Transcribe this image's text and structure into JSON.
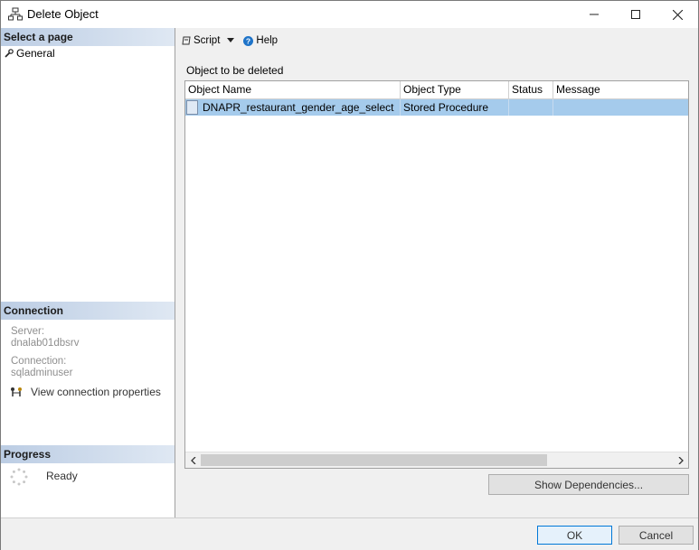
{
  "window": {
    "title": "Delete Object",
    "icon": "object-tree-icon",
    "controls": {
      "minimize": "—",
      "maximize": "☐",
      "close": "✕"
    }
  },
  "left": {
    "select_page_header": "Select a page",
    "pages": [
      {
        "label": "General",
        "icon": "wrench-icon"
      }
    ],
    "connection_header": "Connection",
    "server_label": "Server:",
    "server_value": "dnalab01dbsrv",
    "connection_label": "Connection:",
    "connection_value": "sqladminuser",
    "view_conn_props": "View connection properties",
    "progress_header": "Progress",
    "progress_status": "Ready"
  },
  "toolbar": {
    "script_label": "Script",
    "help_label": "Help"
  },
  "main": {
    "section_label": "Object to be deleted",
    "columns": [
      "Object Name",
      "Object Type",
      "Status",
      "Message"
    ],
    "rows": [
      {
        "name": "DNAPR_restaurant_gender_age_select",
        "type": "Stored Procedure",
        "status": "",
        "message": ""
      }
    ],
    "show_deps_label": "Show Dependencies..."
  },
  "buttons": {
    "ok": "OK",
    "cancel": "Cancel"
  },
  "colors": {
    "selection": "#a5cbec",
    "header_gradient_start": "#bccde4",
    "accent": "#0078d7"
  }
}
